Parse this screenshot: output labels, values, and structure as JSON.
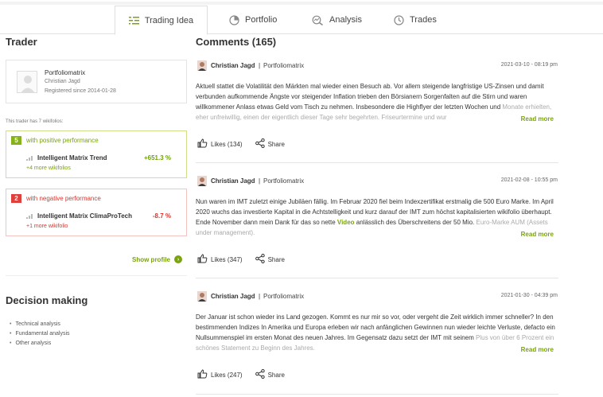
{
  "tabs": [
    {
      "label": "Trading Idea",
      "icon": "chart-lines-icon",
      "active": true
    },
    {
      "label": "Portfolio",
      "icon": "pie-chart-icon",
      "active": false
    },
    {
      "label": "Analysis",
      "icon": "magnifier-chart-icon",
      "active": false
    },
    {
      "label": "Trades",
      "icon": "clock-icon",
      "active": false
    }
  ],
  "trader": {
    "heading": "Trader",
    "name": "Portfoliomatrix",
    "person": "Christian Jagd",
    "registered": "Registered since 2014-01-28",
    "wikifolio_note": "This trader has 7 wikifolios:",
    "positive": {
      "count": "5",
      "title": "with positive performance",
      "wikifolio": "Intelligent Matrix Trend",
      "value": "+651.3 %",
      "more": "+4 more wikifolios"
    },
    "negative": {
      "count": "2",
      "title": "with negative performance",
      "wikifolio": "Intelligent Matrix ClimaProTech",
      "value": "-8.7 %",
      "more": "+1 more wikifolio"
    },
    "show_profile": "Show profile"
  },
  "decision": {
    "heading": "Decision making",
    "items": [
      "Technical analysis",
      "Fundamental analysis",
      "Other analysis"
    ]
  },
  "comments": {
    "heading": "Comments (165)",
    "read_more": "Read more",
    "share": "Share",
    "items": [
      {
        "author": "Christian Jagd",
        "separator": "|",
        "wikifolio": "Portfoliomatrix",
        "date": "2021-03-10 - 08:19 pm",
        "text": "Aktuell stattet die Volatilität den Märkten mal wieder einen Besuch ab. Vor allem steigende langfristige US-Zinsen und damit verbunden aufkommende Ängste vor steigender Inflation trieben den Börsianern Sorgenfalten auf die Stirn und waren willkommener Anlass etwas Geld vom Tisch zu nehmen. Insbesondere die Highflyer der letzten Wochen und",
        "text_fade": "Monate erhielten, eher unfreiwillig, einen der eigentlich dieser Tage sehr begehrten. Friseurtermine und wur",
        "likes": "Likes (134)"
      },
      {
        "author": "Christian Jagd",
        "separator": "|",
        "wikifolio": "Portfoliomatrix",
        "date": "2021-02-08 - 10:55 pm",
        "text": "Nun waren im IMT zuletzt einige Jubiläen fällig. Im Februar 2020 fiel beim Indexzertifikat erstmalig die 500 Euro Marke. Im April 2020 wuchs das investierte Kapital in die Achtstelligkeit und kurz darauf der IMT zum höchst kapitalisierten wikifolio überhaupt. Ende November dann mein Dank für das so nette",
        "link": "Video",
        "text_after": "anlässlich des Überschreitens der 50 Mio.",
        "text_fade": "Euro-Marke AUM (Assets under management).",
        "likes": "Likes (347)"
      },
      {
        "author": "Christian Jagd",
        "separator": "|",
        "wikifolio": "Portfoliomatrix",
        "date": "2021-01-30 - 04:39 pm",
        "text": "Der Januar ist schon wieder ins Land gezogen. Kommt es nur mir so vor, oder vergeht die Zeit wirklich immer schneller? In den bestimmenden Indizes In Amerika und Europa erleben wir nach anfänglichen Gewinnen nun wieder leichte Verluste, defacto ein Nullsummenspiel im ersten Monat des neuen Jahres. Im Gegensatz dazu setzt der IMT mit seinem",
        "text_fade": "Plus von über 6 Prozent ein schönes Statement zu Beginn des Jahres.",
        "likes": "Likes (247)"
      }
    ]
  },
  "colors": {
    "accent_green": "#7aa30f",
    "negative_red": "#d9362f"
  }
}
